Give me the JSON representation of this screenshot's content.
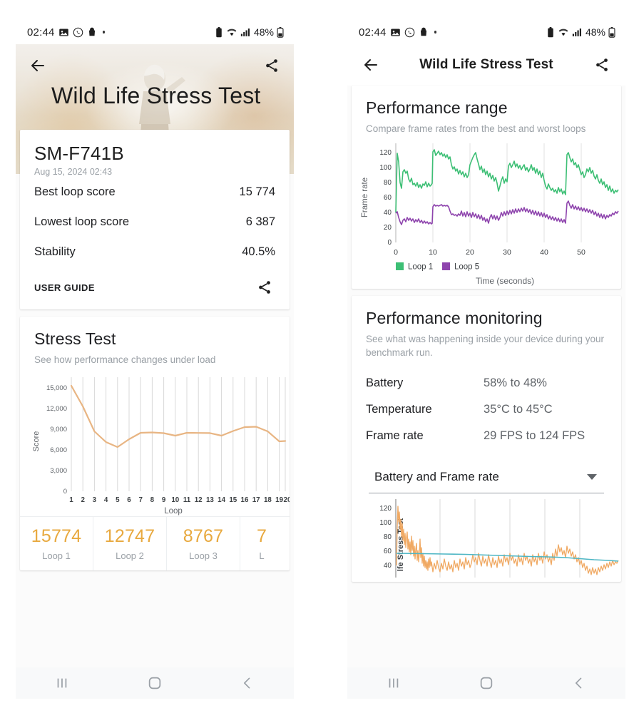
{
  "status_bar": {
    "time": "02:44",
    "icons": [
      "gallery-icon",
      "whatsapp-icon",
      "bag-icon",
      "dot-icon"
    ],
    "right_icons": [
      "battery-saver-icon",
      "wifi-icon",
      "signal-icon"
    ],
    "battery": "48%"
  },
  "left": {
    "hero_title": "Wild Life Stress Test",
    "back_icon": "back-arrow-icon",
    "share_icon": "share-icon",
    "device": {
      "name": "SM-F741B",
      "date": "Aug 15, 2024 02:43",
      "rows": [
        {
          "label": "Best loop score",
          "value": "15 774"
        },
        {
          "label": "Lowest loop score",
          "value": "6 387"
        },
        {
          "label": "Stability",
          "value": "40.5%"
        }
      ],
      "user_guide": "USER GUIDE"
    },
    "stress": {
      "title": "Stress Test",
      "subtitle": "See how performance changes under load"
    },
    "loops": [
      {
        "score": "15774",
        "label": "Loop 1"
      },
      {
        "score": "12747",
        "label": "Loop 2"
      },
      {
        "score": "8767",
        "label": "Loop 3"
      },
      {
        "score": "7",
        "label": "L"
      }
    ]
  },
  "right": {
    "title": "Wild Life Stress Test",
    "back_icon": "back-arrow-icon",
    "share_icon": "share-icon",
    "performance_range": {
      "title": "Performance range",
      "subtitle": "Compare frame rates from the best and worst loops"
    },
    "performance_monitoring": {
      "title": "Performance monitoring",
      "subtitle": "See what was happening inside your device during your benchmark run.",
      "rows": [
        {
          "label": "Battery",
          "value": "58% to 48%"
        },
        {
          "label": "Temperature",
          "value": "35°C to 45°C"
        },
        {
          "label": "Frame rate",
          "value": "29 FPS to 124 FPS"
        }
      ],
      "selected_graph": "Battery and Frame rate",
      "dropdown_icon": "chevron-down-icon"
    }
  },
  "navbar": {
    "recents_icon": "recents-icon",
    "home_icon": "home-icon",
    "back_icon": "back-chevron-icon"
  },
  "colors": {
    "score_amber": "#e8a93f",
    "loop1_green": "#3dbf75",
    "loop5_purple": "#8e44ad",
    "battery_teal": "#4db6c4",
    "frame_orange": "#f0a963"
  },
  "chart_data": [
    {
      "id": "stress-test-chart",
      "type": "line",
      "title": "Stress Test",
      "xlabel": "Loop",
      "ylabel": "Score",
      "xlim": [
        1,
        20
      ],
      "ylim": [
        0,
        16500
      ],
      "yticks": [
        0,
        3000,
        6000,
        9000,
        12000,
        15000
      ],
      "ytick_labels": [
        "0",
        "3,000",
        "6,000",
        "9,000",
        "12,000",
        "15,000"
      ],
      "categories": [
        1,
        2,
        3,
        4,
        5,
        6,
        7,
        8,
        9,
        10,
        11,
        12,
        13,
        14,
        15,
        16,
        17,
        18,
        19,
        20
      ],
      "grid": true,
      "series": [
        {
          "name": "Score",
          "color": "#e8b583",
          "values": [
            15774,
            12747,
            8767,
            7200,
            6387,
            7500,
            8350,
            8400,
            8300,
            8000,
            8350,
            8330,
            8320,
            8000,
            8550,
            9100,
            9150,
            8450,
            7350,
            7400
          ]
        }
      ]
    },
    {
      "id": "performance-range-chart",
      "type": "line",
      "title": "Performance range",
      "xlabel": "Time (seconds)",
      "ylabel": "Frame rate",
      "xlim": [
        0,
        59
      ],
      "ylim": [
        0,
        132
      ],
      "yticks": [
        0,
        20,
        40,
        60,
        80,
        100,
        120
      ],
      "xticks": [
        0,
        10,
        20,
        30,
        40,
        50
      ],
      "grid": true,
      "legend": [
        "Loop 1",
        "Loop 5"
      ],
      "legend_position": "bottom-left",
      "series": [
        {
          "name": "Loop 1",
          "color": "#3dbf75"
        },
        {
          "name": "Loop 5",
          "color": "#8e44ad"
        }
      ]
    },
    {
      "id": "battery-framerate-chart",
      "type": "line",
      "title": "Battery and Frame rate",
      "ylim": [
        30,
        132
      ],
      "yticks": [
        40,
        60,
        80,
        100,
        120
      ],
      "grid": true,
      "ylabel_overlay": "lfe Stress Test",
      "series": [
        {
          "name": "Frame rate",
          "color": "#f0a963"
        },
        {
          "name": "Battery",
          "color": "#4db6c4"
        }
      ]
    }
  ]
}
